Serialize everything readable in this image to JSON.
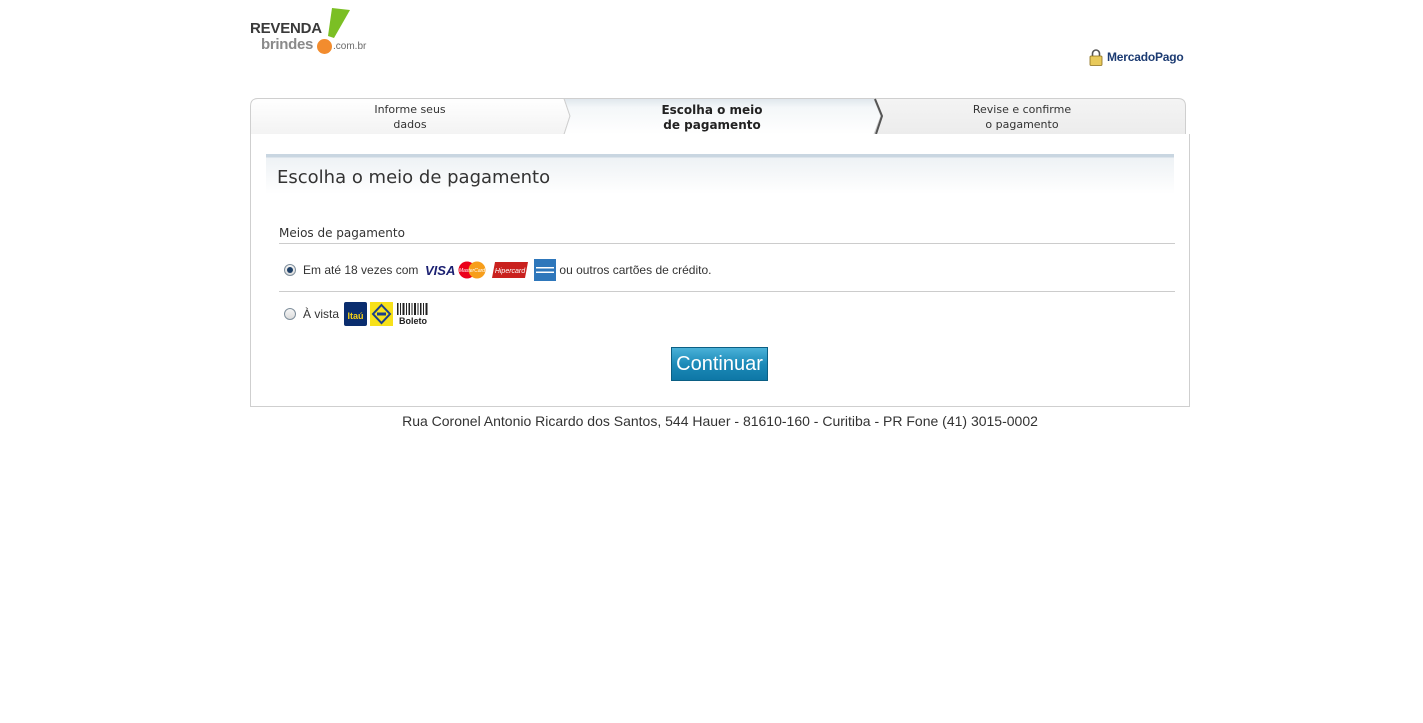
{
  "brand": {
    "line1": "REVENDA",
    "line2": "brindes",
    "line3": ".com.br"
  },
  "security": {
    "label": "MercadoPago",
    "icon": "padlock-icon"
  },
  "steps": [
    {
      "line1": "Informe seus",
      "line2": "dados",
      "active": false
    },
    {
      "line1": "Escolha o meio",
      "line2": "de pagamento",
      "active": true
    },
    {
      "line1": "Revise e confirme",
      "line2": "o pagamento",
      "active": false
    }
  ],
  "section": {
    "title": "Escolha o meio de pagamento",
    "subtitle": "Meios de pagamento"
  },
  "options": {
    "credit": {
      "prefix": "Em até 18 vezes com",
      "suffix": "ou outros cartões de crédito.",
      "selected": true,
      "cards": {
        "visa": "VISA",
        "mastercard": "MasterCard",
        "hipercard": "Hipercard"
      }
    },
    "cash": {
      "label": "À vista",
      "selected": false,
      "bank1": "Itaú",
      "boleto": "Boleto"
    }
  },
  "continue_label": "Continuar",
  "footer": "Rua Coronel Antonio Ricardo dos Santos, 544 Hauer - 81610-160 - Curitiba - PR Fone (41) 3015-0002",
  "colors": {
    "accent_green": "#7bbf24",
    "accent_orange": "#f28c2e",
    "button": "#1c8ab8",
    "mp_blue": "#1c3b72"
  }
}
